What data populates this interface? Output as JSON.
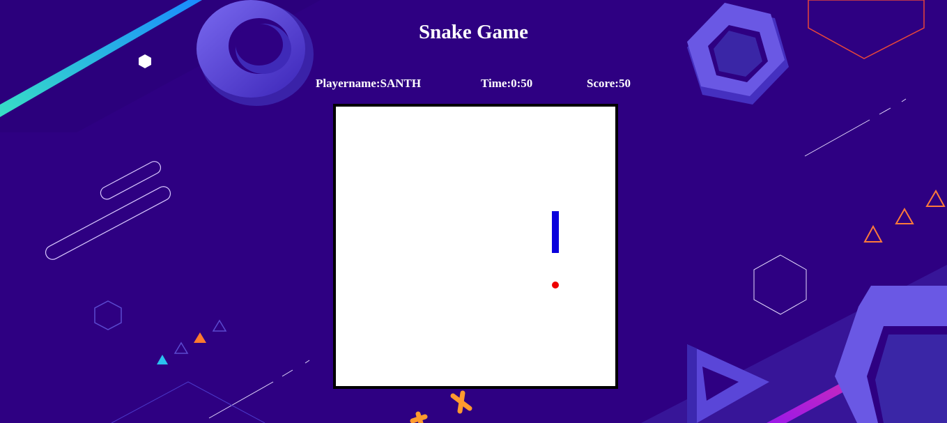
{
  "game": {
    "title": "Snake Game",
    "stats": {
      "player_label": "Playername:",
      "player_value": "SANTH",
      "time_label": "Time:",
      "time_value": "0:50",
      "score_label": "Score:",
      "score_value": "50"
    },
    "board": {
      "background": "#ffffff",
      "border_color": "#000000",
      "snake_color": "#0a00dc",
      "food_color": "#ee0000",
      "snake_orientation": "vertical",
      "snake_length_cells": 6
    }
  },
  "colors": {
    "page_background": "#2e0082",
    "accent_violet": "#5a46d8",
    "accent_orange": "#ff7a2e",
    "accent_cyan": "#2bc1f0",
    "accent_magenta": "#c21ce0"
  }
}
